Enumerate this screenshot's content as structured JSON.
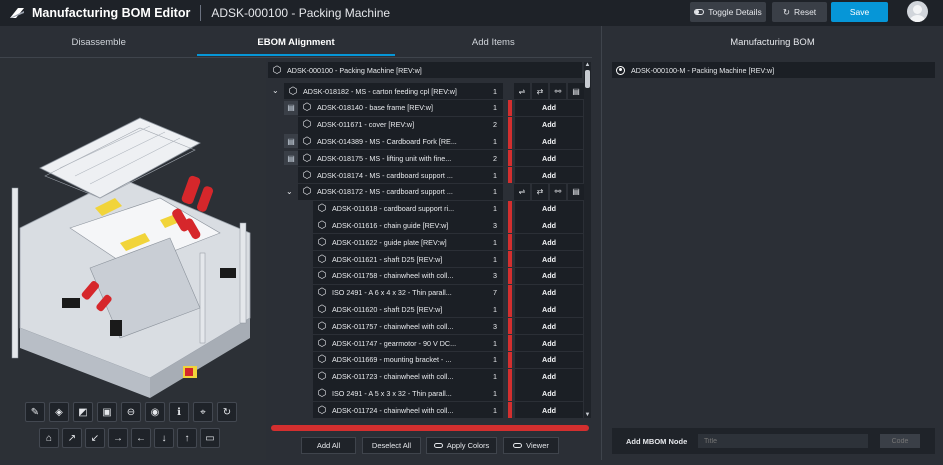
{
  "header": {
    "app_title": "Manufacturing BOM Editor",
    "doc_title": "ADSK-000100 - Packing Machine",
    "toggle_details": "Toggle Details",
    "reset": "Reset",
    "save": "Save"
  },
  "tabs": [
    {
      "label": "Disassemble"
    },
    {
      "label": "EBOM Alignment"
    },
    {
      "label": "Add Items"
    }
  ],
  "ebom": {
    "root": "ADSK-000100 - Packing Machine [REV:w]",
    "rows": [
      {
        "label": "ADSK-018182 - MS - carton feeding cpl [REV:w]",
        "qty": "1"
      },
      {
        "label": "ADSK-018140 - base frame [REV:w]",
        "qty": "1"
      },
      {
        "label": "ADSK-011671 - cover [REV:w]",
        "qty": "2"
      },
      {
        "label": "ADSK-014389 - MS - Cardboard Fork [RE...",
        "qty": "1"
      },
      {
        "label": "ADSK-018175 - MS - lifting unit with fine...",
        "qty": "2"
      },
      {
        "label": "ADSK-018174 - MS - cardboard support ...",
        "qty": "1"
      },
      {
        "label": "ADSK-018172 - MS - cardboard support ...",
        "qty": "1"
      },
      {
        "label": "ADSK-011618 - cardboard support ri...",
        "qty": "1"
      },
      {
        "label": "ADSK-011616 - chain guide [REV:w]",
        "qty": "3"
      },
      {
        "label": "ADSK-011622 - guide plate [REV:w]",
        "qty": "1"
      },
      {
        "label": "ADSK-011621 - shaft D25 [REV:w]",
        "qty": "1"
      },
      {
        "label": "ADSK-011758 - chainwheel with coll...",
        "qty": "3"
      },
      {
        "label": "ISO 2491 - A 6 x 4 x 32 - Thin parall...",
        "qty": "7"
      },
      {
        "label": "ADSK-011620 - shaft D25 [REV:w]",
        "qty": "1"
      },
      {
        "label": "ADSK-011757 - chainwheel with coll...",
        "qty": "3"
      },
      {
        "label": "ADSK-011747 - gearmotor - 90 V DC...",
        "qty": "1"
      },
      {
        "label": "ADSK-011669 - mounting bracket - ...",
        "qty": "1"
      },
      {
        "label": "ADSK-011723 - chainwheel with coll...",
        "qty": "1"
      },
      {
        "label": "ISO 2491 - A 5 x 3 x 32 - Thin parall...",
        "qty": "1"
      },
      {
        "label": "ADSK-011724 - chainwheel with coll...",
        "qty": "1"
      }
    ],
    "add_label": "Add"
  },
  "actions": {
    "add_all": "Add All",
    "deselect_all": "Deselect All",
    "apply_colors": "Apply Colors",
    "viewer": "Viewer"
  },
  "mbom": {
    "title": "Manufacturing BOM",
    "root": "ADSK-000100-M - Packing Machine [REV:w]",
    "add_node_label": "Add MBOM Node",
    "title_placeholder": "Title",
    "code_placeholder": "Code"
  },
  "colors": {
    "accent": "#0696d7",
    "alert": "#d32f2f",
    "panel": "#2b2f36",
    "row": "#1b1f25"
  },
  "icons": {
    "item": "cube-icon",
    "expand": "chevron-down-icon"
  }
}
